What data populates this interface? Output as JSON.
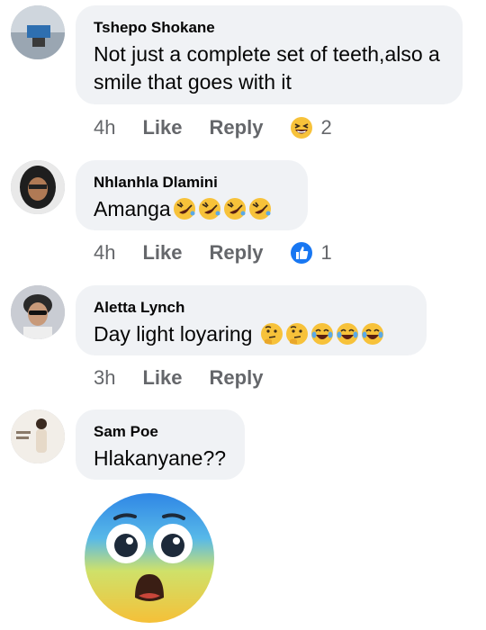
{
  "comments": [
    {
      "author": "Tshepo Shokane",
      "text": "Not just a complete set of teeth,also a smile that goes with it",
      "time": "4h",
      "like_label": "Like",
      "reply_label": "Reply",
      "reaction_icon": "grinning-squinting-icon",
      "reaction_count": "2"
    },
    {
      "author": "Nhlanhla Dlamini",
      "text": "Amanga",
      "inline_emojis": [
        "rolling-on-floor-laughing-icon",
        "rolling-on-floor-laughing-icon",
        "rolling-on-floor-laughing-icon",
        "rolling-on-floor-laughing-icon"
      ],
      "time": "4h",
      "like_label": "Like",
      "reply_label": "Reply",
      "reaction_icon": "like-thumbs-up-icon",
      "reaction_count": "1"
    },
    {
      "author": "Aletta Lynch",
      "text": "Day light loyaring",
      "inline_emojis": [
        "thinking-face-icon",
        "thinking-face-icon",
        "tears-of-joy-icon",
        "tears-of-joy-icon",
        "tears-of-joy-icon"
      ],
      "time": "3h",
      "like_label": "Like",
      "reply_label": "Reply"
    },
    {
      "author": "Sam Poe",
      "text": "Hlakanyane??",
      "sticker": "fearful-face-emoji"
    }
  ],
  "colors": {
    "bubble_bg": "#f0f2f5",
    "meta_text": "#65676b",
    "like_blue": "#1877f2"
  }
}
